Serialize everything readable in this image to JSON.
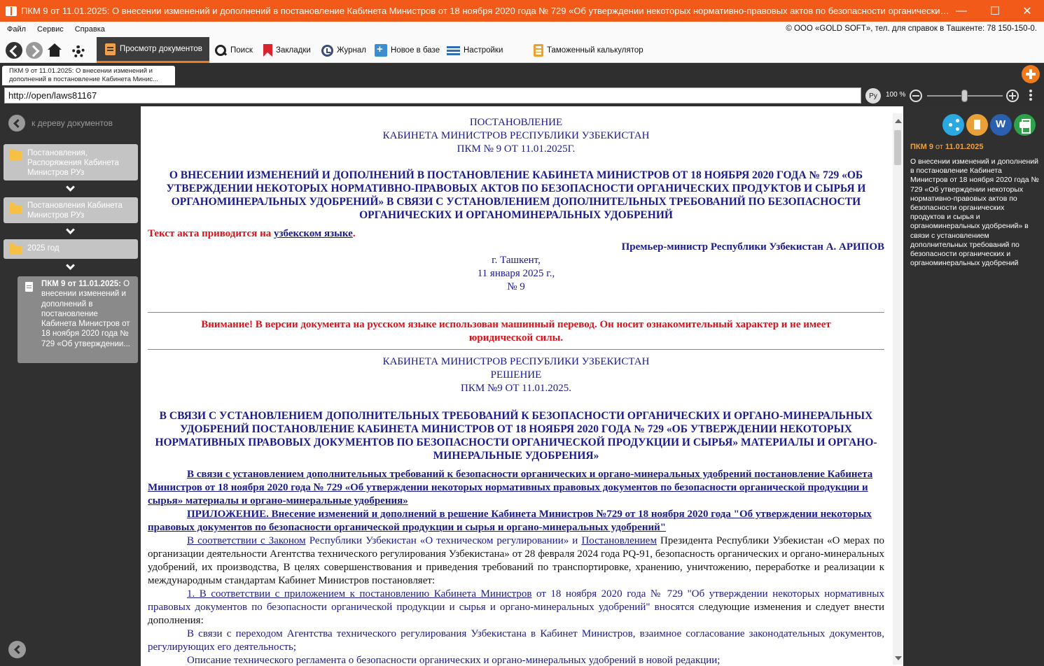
{
  "window": {
    "title": "ПКМ 9 от 11.01.2025: О внесении изменений и дополнений в постановление Кабинета Министров от 18 ноября 2020 года № 729 «Об утверждении некоторых нормативно-правовых актов по  безопасности органических продуктов и сырь...",
    "minimize": "—",
    "maximize": "☐",
    "close": "✕"
  },
  "menu": {
    "file": "Файл",
    "service": "Сервис",
    "help": "Справка",
    "copyright": "© ООО «GOLD SOFT», тел. для справок в Ташкенте: 78 150-150-0."
  },
  "toolbar": {
    "view_documents": "Просмотр документов",
    "search": "Поиск",
    "bookmarks": "Закладки",
    "journal": "Журнал",
    "new_in_base": "Новое в базе",
    "settings": "Настройки",
    "customs_calc": "Таможенный калькулятор"
  },
  "doc_tab": {
    "title": "ПКМ 9 от 11.01.2025: О внесении изменений и дополнений в постановление Кабинета Минис..."
  },
  "address": {
    "url": "http://open/laws81167",
    "lang": "Ру",
    "zoom": "100 %"
  },
  "sidebar": {
    "back_to_tree": "к дереву документов",
    "node1": "Постановления, Распоряжения Кабинета Министров РУз",
    "node2": "Постановления Кабинета Министров РУз",
    "node3": "2025 год",
    "doc_bold": "ПКМ 9 от 11.01.2025:",
    "doc_rest": "О внесении изменений и дополнений в постановление Кабинета Министров от 18 ноября 2020 года № 729 «Об утверждении..."
  },
  "document": {
    "head1": "ПОСТАНОВЛЕНИЕ",
    "head2": "КАБИНЕТА МИНИСТРОВ РЕСПУБЛИКИ УЗБЕКИСТАН",
    "head3": "ПКМ № 9 ОТ 11.01.2025Г.",
    "title": "О ВНЕСЕНИИ ИЗМЕНЕНИЙ И ДОПОЛНЕНИЙ В ПОСТАНОВЛЕНИЕ КАБИНЕТА МИНИСТРОВ ОТ 18 НОЯБРЯ 2020 ГОДА № 729 «ОБ УТВЕРЖДЕНИИ НЕКОТОРЫХ НОРМАТИВНО-ПРАВОВЫХ АКТОВ ПО БЕЗОПАСНОСТИ ОРГАНИЧЕСКИХ ПРОДУКТОВ И СЫРЬЯ И ОРГАНОМИНЕРАЛЬНЫХ УДОБРЕНИЙ» В СВЯЗИ С УСТАНОВЛЕНИЕМ ДОПОЛНИТЕЛЬНЫХ ТРЕБОВАНИЙ ПО БЕЗОПАСНОСТИ ОРГАНИЧЕСКИХ И ОРГАНОМИНЕРАЛЬНЫХ УДОБРЕНИЙ",
    "lang_note_pre": "Текст акта приводится на ",
    "lang_note_link": "узбекском языке",
    "lang_note_post": ".",
    "signer": "Премьер-министр Республики Узбекистан А. АРИПОВ",
    "place": "г. Ташкент,",
    "date": "11 января 2025 г.,",
    "number": "№ 9",
    "warning": "Внимание! В версии документа на русском языке использован машинный перевод. Он носит ознакомительный характер и не имеет юридической силы.",
    "head4": "КАБИНЕТА МИНИСТРОВ РЕСПУБЛИКИ УЗБЕКИСТАН",
    "head5": "РЕШЕНИЕ",
    "head6": "ПКМ №9 ОТ 11.01.2025.",
    "title2": "В СВЯЗИ С УСТАНОВЛЕНИЕМ ДОПОЛНИТЕЛЬНЫХ ТРЕБОВАНИЙ К БЕЗОПАСНОСТИ ОРГАНИЧЕСКИХ И ОРГАНО-МИНЕРАЛЬНЫХ УДОБРЕНИЙ ПОСТАНОВЛЕНИЕ КАБИНЕТА МИНИСТРОВ ОТ 18 НОЯБРЯ 2020 ГОДА № 729 «ОБ УТВЕРЖДЕНИИ НЕКОТОРЫХ НОРМАТИВНЫХ ПРАВОВЫХ ДОКУМЕНТОВ ПО БЕЗОПАСНОСТИ ОРГАНИЧЕСКОЙ ПРОДУКЦИИ И СЫРЬЯ» МАТЕРИАЛЫ И ОРГАНО-МИНЕРАЛЬНЫЕ УДОБРЕНИЯ»",
    "toc1": "В связи с установлением дополнительных требований к безопасности органических и органо-минеральных удобрений постановление Кабинета Министров от 18 ноября 2020 года № 729 «Об утверждении некоторых нормативных правовых документов по безопасности органической продукции и сырья» материалы и органо-минеральные удобрения»",
    "toc2": "ПРИЛОЖЕНИЕ. Внесение изменений и дополнений в решение Кабинета Министров №729 от 18 ноября 2020 года \"Об утверждении некоторых правовых документов по безопасности органической продукции и сырья и органо-минеральных удобрений\"",
    "p1_link1": "В соответствии с Законом",
    "p1_mid": " Республики Узбекистан «О техническом регулировании» и ",
    "p1_link2": "Постановлением",
    "p1_rest": " Президента Республики Узбекистан «О мерах по организации деятельности Агентства технического регулирования Узбекистана» от 28 февраля 2024 года PQ-91, безопасность органических и органо-минеральных удобрений, их производства, В целях совершенствования и приведения требований по транспортировке, хранению, уничтожению, переработке и реализации к международным стандартам Кабинет Министров постановляет:",
    "p2_link": "1. В соответствии с приложением к постановлению Кабинета Министров",
    "p2_blue": " от 18 ноября 2020 года № 729 \"Об утверждении некоторых нормативных правовых документов по безопасности органической продукции и сырья и органо-минеральных удобрений\" вносятся",
    "p2_black": " следующие изменения и следует внести дополнения:",
    "p3": "В связи с переходом Агентства технического регулирования Узбекистана в Кабинет Министров, взаимное согласование законодательных документов, регулирующих его деятельность;",
    "p4": "Описание технического регламента о безопасности органических и органо-минеральных удобрений в новой редакции;"
  },
  "right_panel": {
    "title_num": "ПКМ 9",
    "title_of": " от ",
    "title_date": "11.01.2025",
    "desc": "О внесении изменений и дополнений в постановление Кабинета Министров от 18 ноября 2020 года № 729 «Об утверждении некоторых нормативно-правовых актов по  безопасности органических продуктов и сырья и органоминеральных удобрений» в связи с установлением дополнительных требований по безопасности органических и органоминеральных удобрений"
  }
}
